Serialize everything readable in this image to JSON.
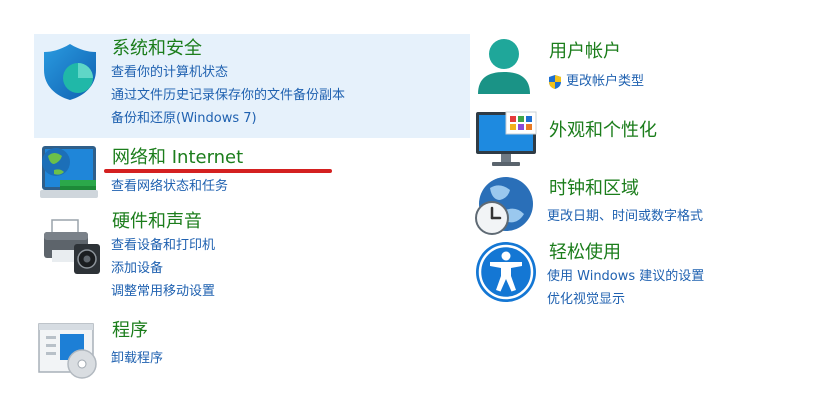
{
  "left": [
    {
      "id": "system-security",
      "title": "系统和安全",
      "links": [
        "查看你的计算机状态",
        "通过文件历史记录保存你的文件备份副本",
        "备份和还原(Windows 7)"
      ]
    },
    {
      "id": "network-internet",
      "title": "网络和 Internet",
      "links": [
        "查看网络状态和任务"
      ]
    },
    {
      "id": "hardware-sound",
      "title": "硬件和声音",
      "links": [
        "查看设备和打印机",
        "添加设备",
        "调整常用移动设置"
      ]
    },
    {
      "id": "programs",
      "title": "程序",
      "links": [
        "卸载程序"
      ]
    }
  ],
  "right": [
    {
      "id": "user-accounts",
      "title": "用户帐户",
      "links": [
        "更改帐户类型"
      ]
    },
    {
      "id": "appearance",
      "title": "外观和个性化",
      "links": []
    },
    {
      "id": "clock-region",
      "title": "时钟和区域",
      "links": [
        "更改日期、时间或数字格式"
      ]
    },
    {
      "id": "ease-of-access",
      "title": "轻松使用",
      "links": [
        "使用 Windows 建议的设置",
        "优化视觉显示"
      ]
    }
  ],
  "colors": {
    "title_green": "#1b7d1b",
    "link_blue": "#1f61b0",
    "highlight": "#e6f1fb",
    "annotation_red": "#d42020"
  },
  "icons": {
    "system-security": "shield-icon",
    "network-internet": "network-globe-icon",
    "hardware-sound": "printer-speaker-icon",
    "programs": "program-disc-icon",
    "user-accounts": "user-icon",
    "appearance": "monitor-icon",
    "clock-region": "globe-clock-icon",
    "ease-of-access": "accessibility-icon"
  }
}
